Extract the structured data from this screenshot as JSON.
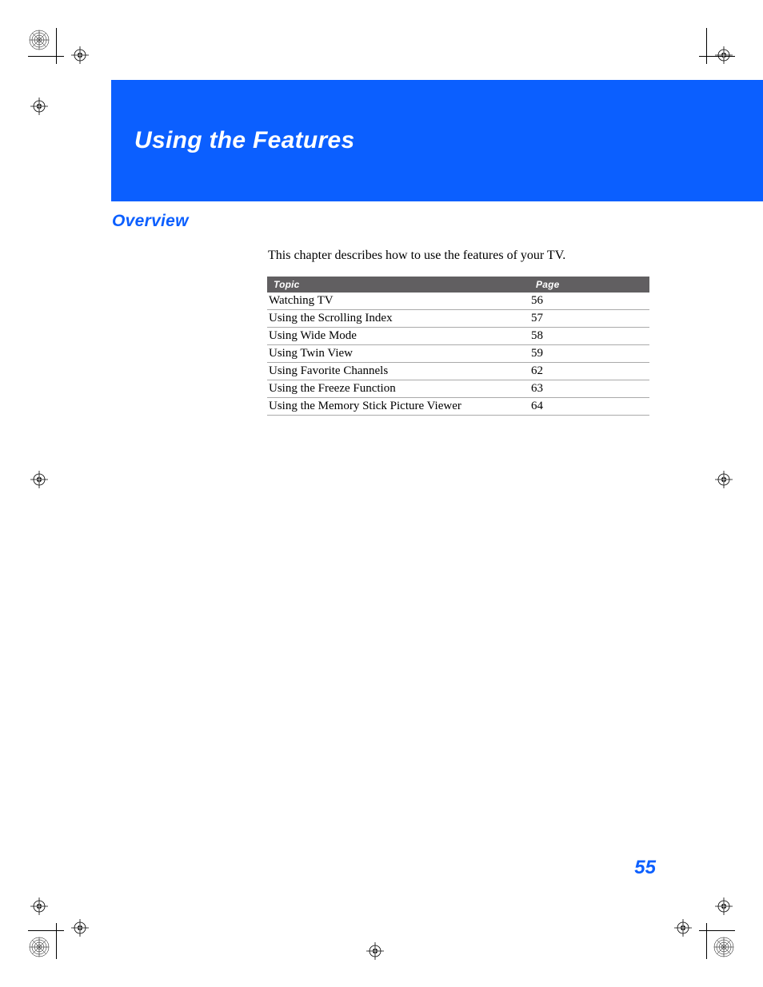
{
  "banner": {
    "title": "Using the Features"
  },
  "overview": {
    "heading": "Overview",
    "intro": "This chapter describes how to use the features of your TV."
  },
  "table": {
    "headers": {
      "topic": "Topic",
      "page": "Page"
    },
    "rows": [
      {
        "topic": "Watching TV",
        "page": "56"
      },
      {
        "topic": "Using the Scrolling Index",
        "page": "57"
      },
      {
        "topic": "Using Wide Mode",
        "page": "58"
      },
      {
        "topic": "Using Twin View",
        "page": "59"
      },
      {
        "topic": "Using Favorite Channels",
        "page": "62"
      },
      {
        "topic": "Using the Freeze Function",
        "page": "63"
      },
      {
        "topic": "Using the Memory Stick Picture Viewer",
        "page": "64"
      }
    ]
  },
  "pageNumber": "55"
}
